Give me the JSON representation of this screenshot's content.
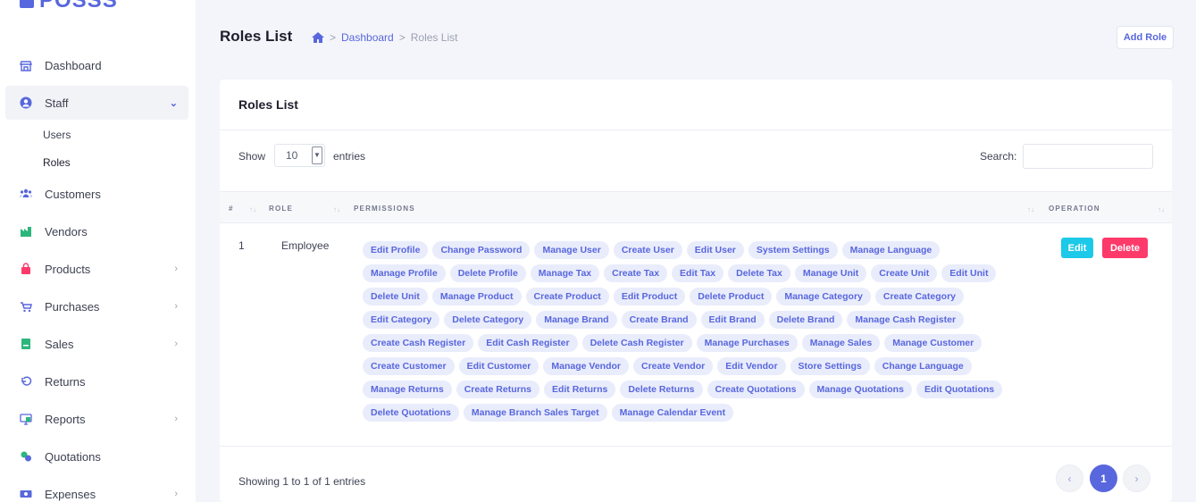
{
  "logo": {
    "text": "POSSS"
  },
  "sidebar": {
    "items": [
      {
        "label": "Dashboard",
        "icon": "storefront-icon",
        "expandable": false
      },
      {
        "label": "Staff",
        "icon": "user-circle-icon",
        "expandable": true,
        "expanded": true
      },
      {
        "label": "Customers",
        "icon": "users-group-icon",
        "expandable": false
      },
      {
        "label": "Vendors",
        "icon": "factory-icon",
        "expandable": false
      },
      {
        "label": "Products",
        "icon": "shopping-bag-icon",
        "expandable": true
      },
      {
        "label": "Purchases",
        "icon": "cart-icon",
        "expandable": true
      },
      {
        "label": "Sales",
        "icon": "ledger-icon",
        "expandable": true
      },
      {
        "label": "Returns",
        "icon": "undo-icon",
        "expandable": false
      },
      {
        "label": "Reports",
        "icon": "monitor-chart-icon",
        "expandable": true
      },
      {
        "label": "Quotations",
        "icon": "handshake-icon",
        "expandable": false
      },
      {
        "label": "Expenses",
        "icon": "money-icon",
        "expandable": true
      }
    ],
    "staff_sub": [
      {
        "label": "Users"
      },
      {
        "label": "Roles"
      }
    ]
  },
  "header": {
    "title": "Roles List",
    "breadcrumb": {
      "home_icon": "home-icon",
      "sep": ">",
      "dashboard": "Dashboard",
      "current": "Roles List"
    },
    "add_button": "Add Role"
  },
  "card": {
    "title": "Roles List",
    "show_label": "Show",
    "entries_value": "10",
    "entries_label": "entries",
    "search_label": "Search:",
    "columns": {
      "num": "#",
      "role": "ROLE",
      "permissions": "PERMISSIONS",
      "operation": "OPERATION"
    },
    "row": {
      "num": "1",
      "role": "Employee",
      "permissions": [
        "Edit Profile",
        "Change Password",
        "Manage User",
        "Create User",
        "Edit User",
        "System Settings",
        "Manage Language",
        "Manage Profile",
        "Delete Profile",
        "Manage Tax",
        "Create Tax",
        "Edit Tax",
        "Delete Tax",
        "Manage Unit",
        "Create Unit",
        "Edit Unit",
        "Delete Unit",
        "Manage Product",
        "Create Product",
        "Edit Product",
        "Delete Product",
        "Manage Category",
        "Create Category",
        "Edit Category",
        "Delete Category",
        "Manage Brand",
        "Create Brand",
        "Edit Brand",
        "Delete Brand",
        "Manage Cash Register",
        "Create Cash Register",
        "Edit Cash Register",
        "Delete Cash Register",
        "Manage Purchases",
        "Manage Sales",
        "Manage Customer",
        "Create Customer",
        "Edit Customer",
        "Manage Vendor",
        "Create Vendor",
        "Edit Vendor",
        "Store Settings",
        "Change Language",
        "Manage Returns",
        "Create Returns",
        "Edit Returns",
        "Delete Returns",
        "Create Quotations",
        "Manage Quotations",
        "Edit Quotations",
        "Delete Quotations",
        "Manage Branch Sales Target",
        "Manage Calendar Event"
      ],
      "edit_label": "Edit",
      "delete_label": "Delete"
    },
    "footer": {
      "showing": "Showing 1 to 1 of 1 entries",
      "prev": "‹",
      "current_page": "1",
      "next": "›"
    }
  },
  "colors": {
    "accent": "#5867dd",
    "edit": "#1dc9e8",
    "delete": "#fd3a6a",
    "badge_bg": "#e9ecfb"
  }
}
